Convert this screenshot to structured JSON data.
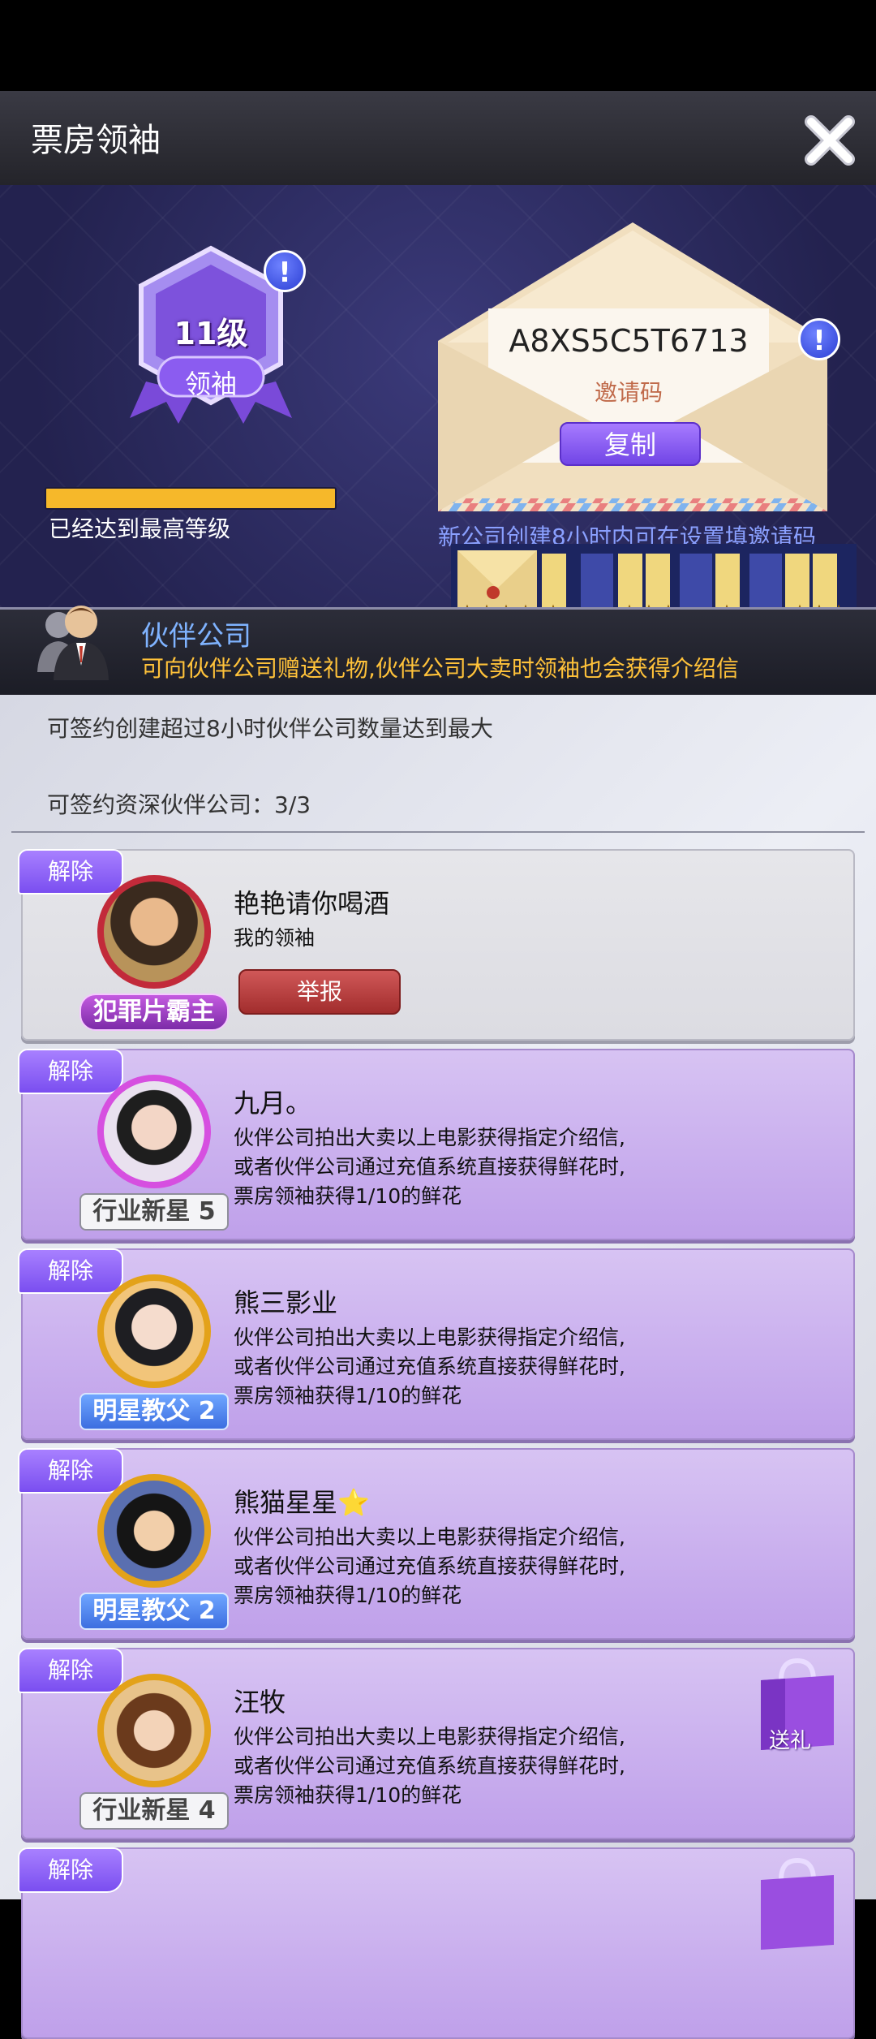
{
  "header": {
    "title": "票房领袖"
  },
  "leader": {
    "level": "11级",
    "rank": "领袖",
    "progress": 1.0,
    "status_text": "已经达到最高等级",
    "alert_glyph": "!"
  },
  "invite": {
    "code": "A8XS5C5T6713",
    "label": "邀请码",
    "copy_label": "复制",
    "note": "新公司创建8小时内可在设置填邀请码",
    "alert_glyph": "!"
  },
  "film_strip": {
    "count": "10"
  },
  "partner": {
    "title": "伙伴公司",
    "description": "可向伙伴公司赠送礼物,伙伴公司大卖时领袖也会获得介绍信"
  },
  "info": {
    "line1": "可签约创建超过8小时伙伴公司数量达到最大",
    "line2": "可签约资深伙伴公司：3/3"
  },
  "release_label": "解除",
  "report_label": "举报",
  "gift_label": "送礼",
  "cards": [
    {
      "name": "艳艳请你喝酒",
      "sub": "我的领袖",
      "rank": "犯罪片霸主"
    },
    {
      "name": "九月。",
      "sub": "伙伴公司拍出大卖以上电影获得指定介绍信,\n或者伙伴公司通过充值系统直接获得鲜花时,\n票房领袖获得1/10的鲜花",
      "rank": "行业新星 5"
    },
    {
      "name": "熊三影业",
      "sub": "伙伴公司拍出大卖以上电影获得指定介绍信,\n或者伙伴公司通过充值系统直接获得鲜花时,\n票房领袖获得1/10的鲜花",
      "rank": "明星教父 2"
    },
    {
      "name": "熊猫星星⭐",
      "sub": "伙伴公司拍出大卖以上电影获得指定介绍信,\n或者伙伴公司通过充值系统直接获得鲜花时,\n票房领袖获得1/10的鲜花",
      "rank": "明星教父 2"
    },
    {
      "name": "汪牧",
      "sub": "伙伴公司拍出大卖以上电影获得指定介绍信,\n或者伙伴公司通过充值系统直接获得鲜花时,\n票房领袖获得1/10的鲜花",
      "rank": "行业新星 4"
    }
  ],
  "colors": {
    "accent_purple": "#7a4ef0",
    "progress_gold": "#f6b82a",
    "partner_title": "#7fb3ff",
    "partner_desc": "#ffc23a"
  },
  "icons": [
    "close-icon",
    "alert-icon",
    "envelope-icon",
    "film-strip-icon",
    "partner-icon",
    "gift-bag-icon",
    "star-icon"
  ]
}
